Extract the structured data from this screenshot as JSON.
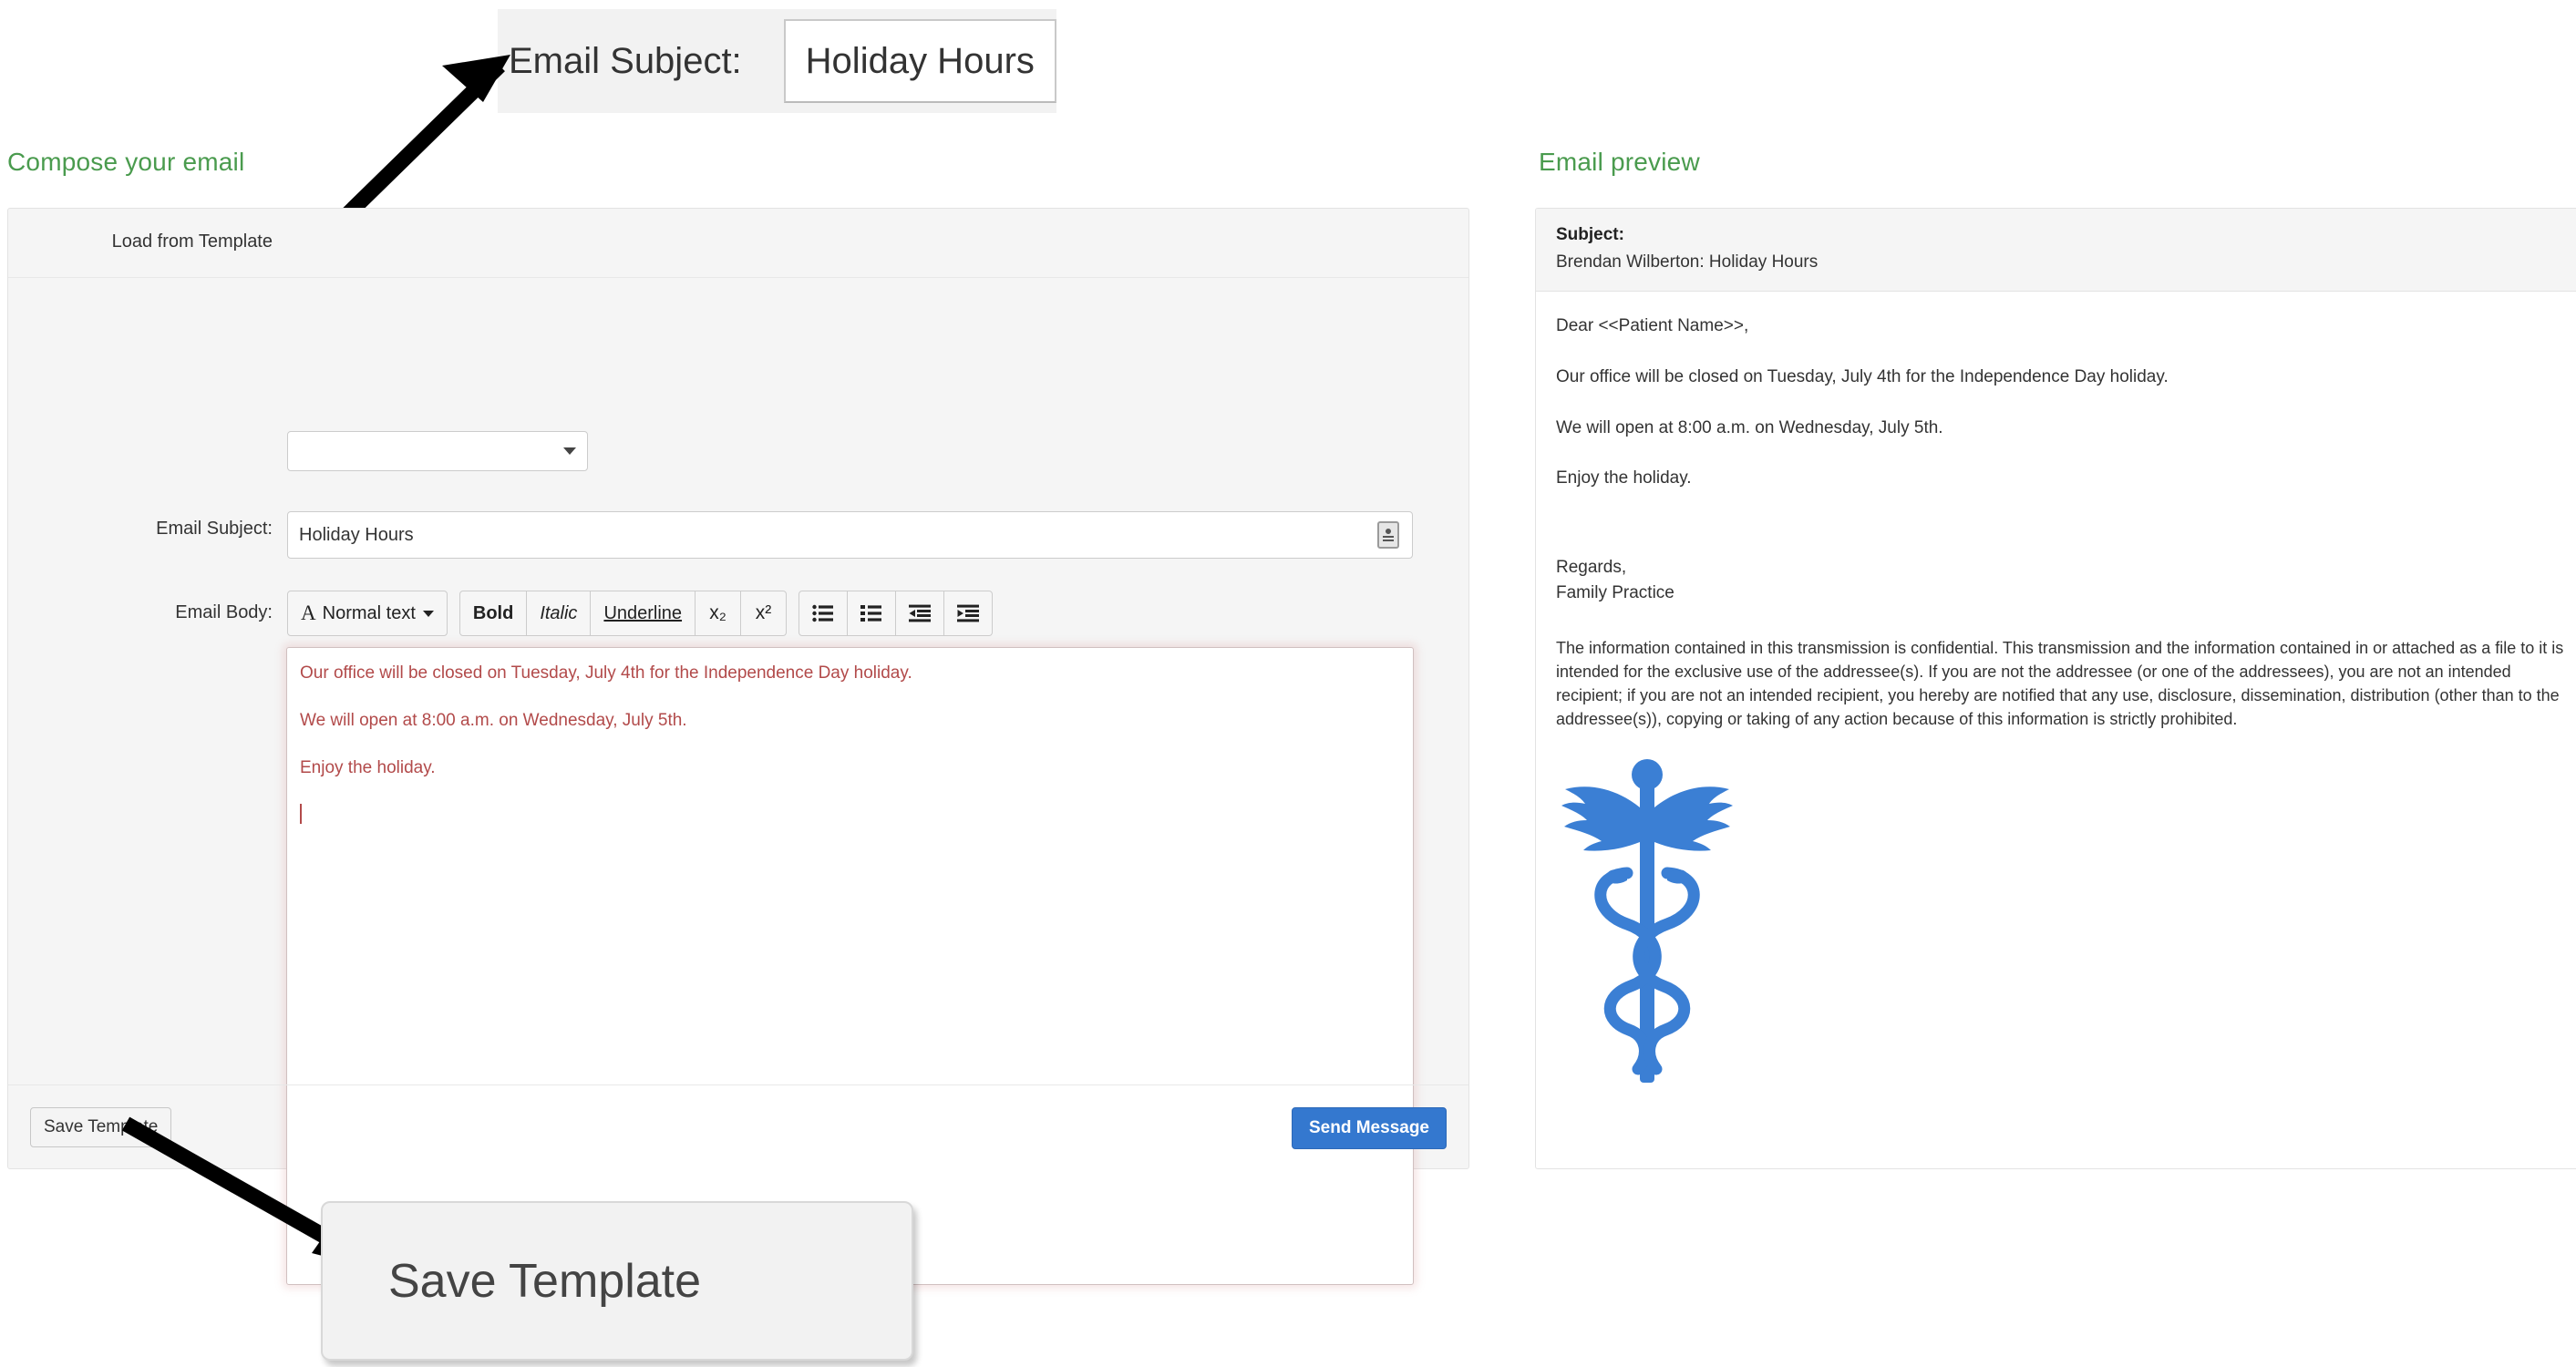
{
  "callouts": {
    "subject": {
      "label": "Email Subject:",
      "value": "Holiday Hours"
    },
    "save_template": {
      "label": "Save Template"
    }
  },
  "compose": {
    "heading": "Compose your email",
    "labels": {
      "load_from_template": "Load from Template",
      "email_subject": "Email Subject:",
      "email_body": "Email Body:"
    },
    "template_select": {
      "value": "",
      "icon": "chevron-down-icon"
    },
    "subject_input": {
      "value": "Holiday Hours",
      "placeholder": "",
      "icon": "contact-card-autofill-icon"
    },
    "toolbar": {
      "style_dropdown": {
        "icon": "font-style-a-icon",
        "label": "Normal text",
        "caret": "caret-down-icon"
      },
      "format_buttons": [
        {
          "label": "Bold",
          "name": "bold-button"
        },
        {
          "label": "Italic",
          "name": "italic-button"
        },
        {
          "label": "Underline",
          "name": "underline-button"
        },
        {
          "label": "x₂",
          "name": "subscript-button"
        },
        {
          "label": "x²",
          "name": "superscript-button"
        }
      ],
      "list_buttons": [
        {
          "icon": "bulleted-list-icon",
          "name": "bulleted-list-button"
        },
        {
          "icon": "numbered-list-icon",
          "name": "numbered-list-button"
        },
        {
          "icon": "outdent-icon",
          "name": "outdent-button"
        },
        {
          "icon": "indent-icon",
          "name": "indent-button"
        }
      ]
    },
    "body": {
      "text_color": "#b24a4a",
      "paragraphs": [
        "Our office will be closed on Tuesday, July 4th for the Independence Day holiday.",
        "We will open at 8:00 a.m. on Wednesday, July 5th.",
        "Enjoy the holiday."
      ]
    },
    "footer": {
      "save_template_label": "Save Template",
      "send_message_label": "Send Message",
      "send_message_color": "#3478cf"
    }
  },
  "preview": {
    "heading": "Email preview",
    "subject_label": "Subject:",
    "subject_value": "Brendan Wilberton: Holiday Hours",
    "greeting": "Dear <<Patient Name>>,",
    "paragraphs": [
      "Our office will be closed on Tuesday, July 4th for the Independence Day holiday.",
      "We will open at 8:00 a.m. on Wednesday, July 5th.",
      "Enjoy the holiday."
    ],
    "signoff_line1": "Regards,",
    "signoff_line2": "Family Practice",
    "disclaimer": "The information contained in this transmission is confidential. This transmission and the information contained in or attached as a file to it is intended for the exclusive use of the addressee(s). If you are not the addressee (or one of the addressees), you are not an intended recipient; if you are not an intended recipient, you hereby are notified that any use, disclosure, dissemination, distribution (other than to the addressee(s)), copying or taking of any action because of this information is strictly prohibited.",
    "logo": {
      "name": "caduceus-logo",
      "color": "#3b7fd4"
    }
  },
  "theme": {
    "heading_green": "#4a9b4e",
    "body_red": "#b24a4a",
    "primary_blue": "#3478cf",
    "logo_blue": "#3b7fd4"
  }
}
